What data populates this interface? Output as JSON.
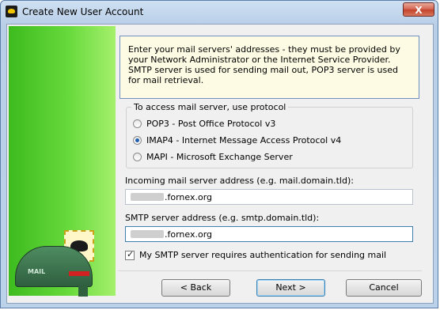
{
  "window": {
    "title": "Create New User Account",
    "close_symbol": "X"
  },
  "info_text": "Enter your mail servers' addresses - they must be provided by your Network Administrator or the Internet Service Provider. SMTP server is used for sending mail out, POP3 server is used for mail retrieval.",
  "protocol_group": {
    "legend": "To access mail server, use protocol",
    "options": [
      {
        "label": "POP3 - Post Office Protocol v3",
        "selected": false
      },
      {
        "label": "IMAP4 - Internet Message Access Protocol v4",
        "selected": true
      },
      {
        "label": "MAPI - Microsoft Exchange Server",
        "selected": false
      }
    ]
  },
  "incoming": {
    "label": "Incoming mail server address (e.g. mail.domain.tld):",
    "value_suffix": ".fornex.org"
  },
  "smtp": {
    "label": "SMTP server address (e.g. smtp.domain.tld):",
    "value_suffix": ".fornex.org"
  },
  "smtp_auth": {
    "label": "My SMTP server requires authentication for sending mail",
    "checked": true
  },
  "buttons": {
    "back": "< Back",
    "next": "Next >",
    "cancel": "Cancel"
  },
  "mailbox_text": "MAIL"
}
